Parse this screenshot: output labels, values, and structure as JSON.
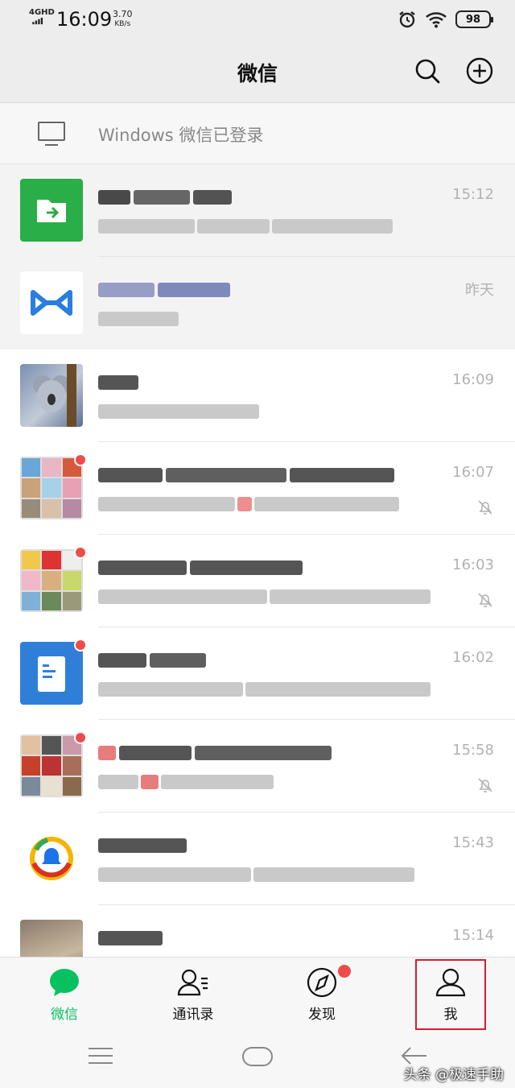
{
  "status_bar": {
    "network": "4GHD",
    "time": "16:09",
    "speed_value": "3.70",
    "speed_unit": "KB/s",
    "battery": "98"
  },
  "header": {
    "title": "微信",
    "icons": [
      "search-icon",
      "add-icon"
    ]
  },
  "login_banner": {
    "text": "Windows 微信已登录",
    "icon": "monitor-icon"
  },
  "chats": [
    {
      "time": "15:12",
      "avatar": "file-transfer",
      "muted": false,
      "unread_dot": false,
      "pinned": true
    },
    {
      "time": "昨天",
      "avatar": "blue-logo",
      "muted": false,
      "unread_dot": false,
      "pinned": true
    },
    {
      "time": "16:09",
      "avatar": "koala-photo",
      "muted": false,
      "unread_dot": false,
      "pinned": false
    },
    {
      "time": "16:07",
      "avatar": "group-collage",
      "muted": true,
      "unread_dot": true,
      "pinned": false
    },
    {
      "time": "16:03",
      "avatar": "group-collage",
      "muted": true,
      "unread_dot": true,
      "pinned": false
    },
    {
      "time": "16:02",
      "avatar": "document-app",
      "muted": false,
      "unread_dot": true,
      "pinned": false
    },
    {
      "time": "15:58",
      "avatar": "group-collage",
      "muted": true,
      "unread_dot": true,
      "pinned": false
    },
    {
      "time": "15:43",
      "avatar": "tencent-news",
      "muted": false,
      "unread_dot": false,
      "pinned": false
    },
    {
      "time": "15:14",
      "avatar": "cat-photo",
      "muted": false,
      "unread_dot": false,
      "pinned": false
    }
  ],
  "tabs": [
    {
      "label": "微信",
      "icon": "chat-bubble-icon",
      "active": true
    },
    {
      "label": "通讯录",
      "icon": "contacts-icon",
      "active": false
    },
    {
      "label": "发现",
      "icon": "compass-icon",
      "active": false,
      "dot": true
    },
    {
      "label": "我",
      "icon": "person-icon",
      "active": false
    }
  ],
  "colors": {
    "accent": "#07c160",
    "badge": "#f04b4b",
    "highlight": "#d21f2b"
  },
  "watermark": "头条 @极速手助"
}
